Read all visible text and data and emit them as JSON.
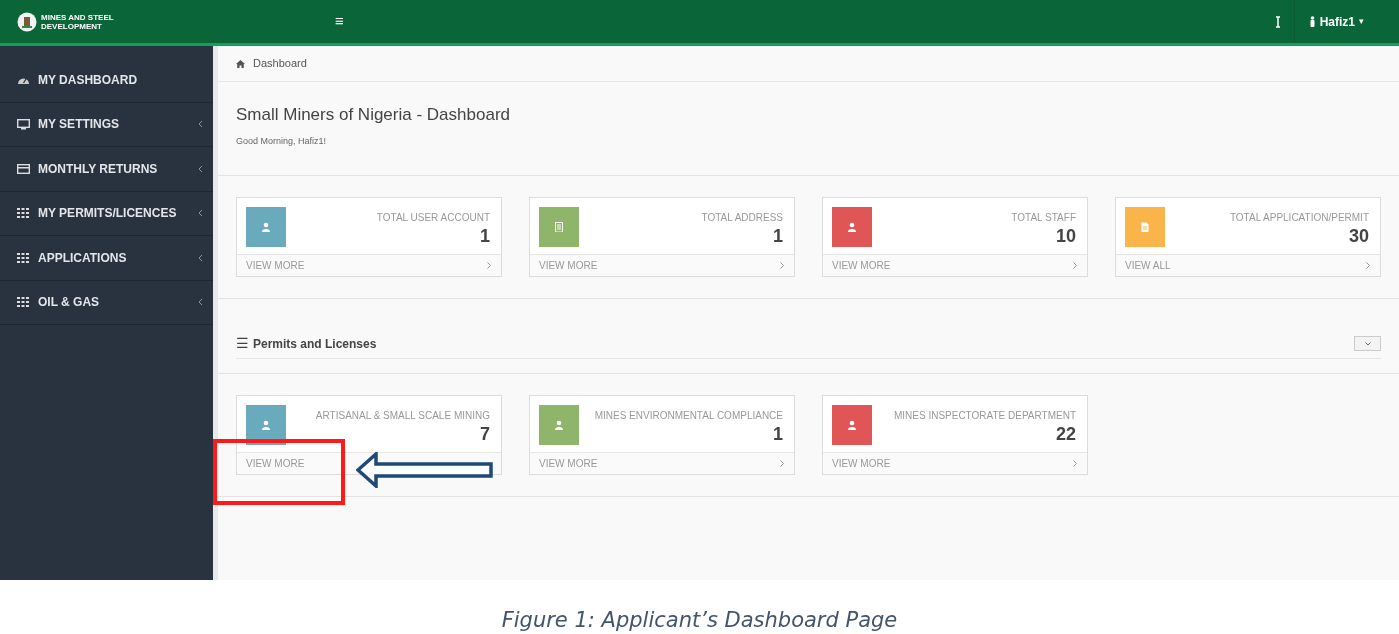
{
  "header": {
    "logo_lines": [
      "MINES AND STEEL",
      "DEVELOPMENT"
    ],
    "menu_icon": "≡",
    "user": "Hafiz1",
    "user_caret": "▾"
  },
  "sidebar": {
    "items": [
      {
        "label": "MY DASHBOARD",
        "kind": "gauge",
        "has_caret": false
      },
      {
        "label": "MY SETTINGS",
        "kind": "monitor",
        "has_caret": true
      },
      {
        "label": "MONTHLY RETURNS",
        "kind": "card",
        "has_caret": true
      },
      {
        "label": "MY PERMITS/LICENCES",
        "kind": "grid",
        "has_caret": true
      },
      {
        "label": "APPLICATIONS",
        "kind": "grid",
        "has_caret": true
      },
      {
        "label": "OIL & GAS",
        "kind": "grid",
        "has_caret": true
      }
    ]
  },
  "breadcrumb": "Dashboard",
  "page": {
    "title": "Small Miners of Nigeria - Dashboard",
    "greeting": "Good Morning, Hafiz1!"
  },
  "stats": [
    {
      "label": "TOTAL USER ACCOUNT",
      "value": "1",
      "link": "VIEW MORE",
      "kind": "user",
      "color": "#6aaabd"
    },
    {
      "label": "TOTAL ADDRESS",
      "value": "1",
      "link": "VIEW MORE",
      "kind": "building",
      "color": "#8fb56a"
    },
    {
      "label": "TOTAL STAFF",
      "value": "10",
      "link": "VIEW MORE",
      "kind": "user",
      "color": "#e05656"
    },
    {
      "label": "TOTAL APPLICATION/PERMIT",
      "value": "30",
      "link": "VIEW ALL",
      "kind": "file",
      "color": "#f9b44a"
    }
  ],
  "permits": {
    "icon": "☰",
    "title": "Permits and Licenses",
    "cards": [
      {
        "label": "ARTISANAL & SMALL SCALE MINING",
        "value": "7",
        "link": "VIEW MORE",
        "kind": "user",
        "color": "#6aaabd",
        "highlighted": true
      },
      {
        "label": "MINES ENVIRONMENTAL COMPLIANCE",
        "value": "1",
        "link": "VIEW MORE",
        "kind": "user",
        "color": "#8fb56a",
        "highlighted": false
      },
      {
        "label": "MINES INSPECTORATE DEPARTMENT",
        "value": "22",
        "link": "VIEW MORE",
        "kind": "user",
        "color": "#e05656",
        "highlighted": false
      }
    ]
  },
  "caption": "Figure 1: Applicant’s Dashboard Page"
}
